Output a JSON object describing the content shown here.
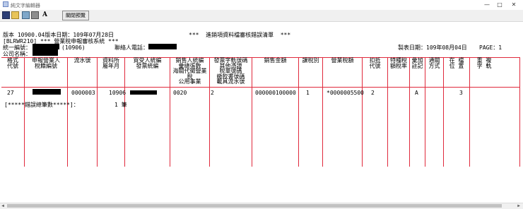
{
  "window": {
    "title": "純文字編輯器"
  },
  "toolbar": {
    "preview_label": "關閉預覽"
  },
  "report": {
    "version_line": "版本 10900.04版本日期：109年07月28日",
    "report_title": "***  進銷項資料檔審核錯誤清單  ***",
    "program_line": "[BLRWR210] *** 營業稅申報審核系統 ***",
    "unify_label": "統一編號：",
    "unify_code": "(10906)",
    "agent_label": "聯絡人電話：",
    "company_label": "公司名稱：",
    "print_date": "製表日期：109年08月04日",
    "page_no": "PAGE：1"
  },
  "columns": [
    {
      "label": "格式\n代號"
    },
    {
      "label": "申報營業人\n稅籍編號"
    },
    {
      "label": "流水號"
    },
    {
      "label": "資料所\n屬年月"
    },
    {
      "label": "買受人統編\n發票統編"
    },
    {
      "label": "銷售人統編\n彙總張數\n海關代徵營業稅\n公用事業"
    },
    {
      "label": "發票字軌號碼\n其他憑證\n稅單號碼\n繳款書號碼\n載具流水號"
    },
    {
      "label": "銷售金額"
    },
    {
      "label": "課稅別"
    },
    {
      "label": "營業稅額"
    },
    {
      "label": "扣抵\n代號"
    },
    {
      "label": "特種稅\n額稅率"
    },
    {
      "label": "彙加\n註記"
    },
    {
      "label": "通關\n方式"
    },
    {
      "label": "在 檔\n位 置"
    },
    {
      "label": "重 複\n字 軌"
    }
  ],
  "rows": [
    {
      "format_code": "27",
      "serial_no": "0000003",
      "period": "10906",
      "seller_code": "0020",
      "invoice_track": "2",
      "sales_amount": "000000100000",
      "tax_type": "1",
      "tax_amount": "*0000005500",
      "deduct_code": "2",
      "summary_flag": "A",
      "position": "3"
    }
  ],
  "error_summary": {
    "label": "[*****錯誤總筆數*****]：",
    "count": "1 筆"
  }
}
